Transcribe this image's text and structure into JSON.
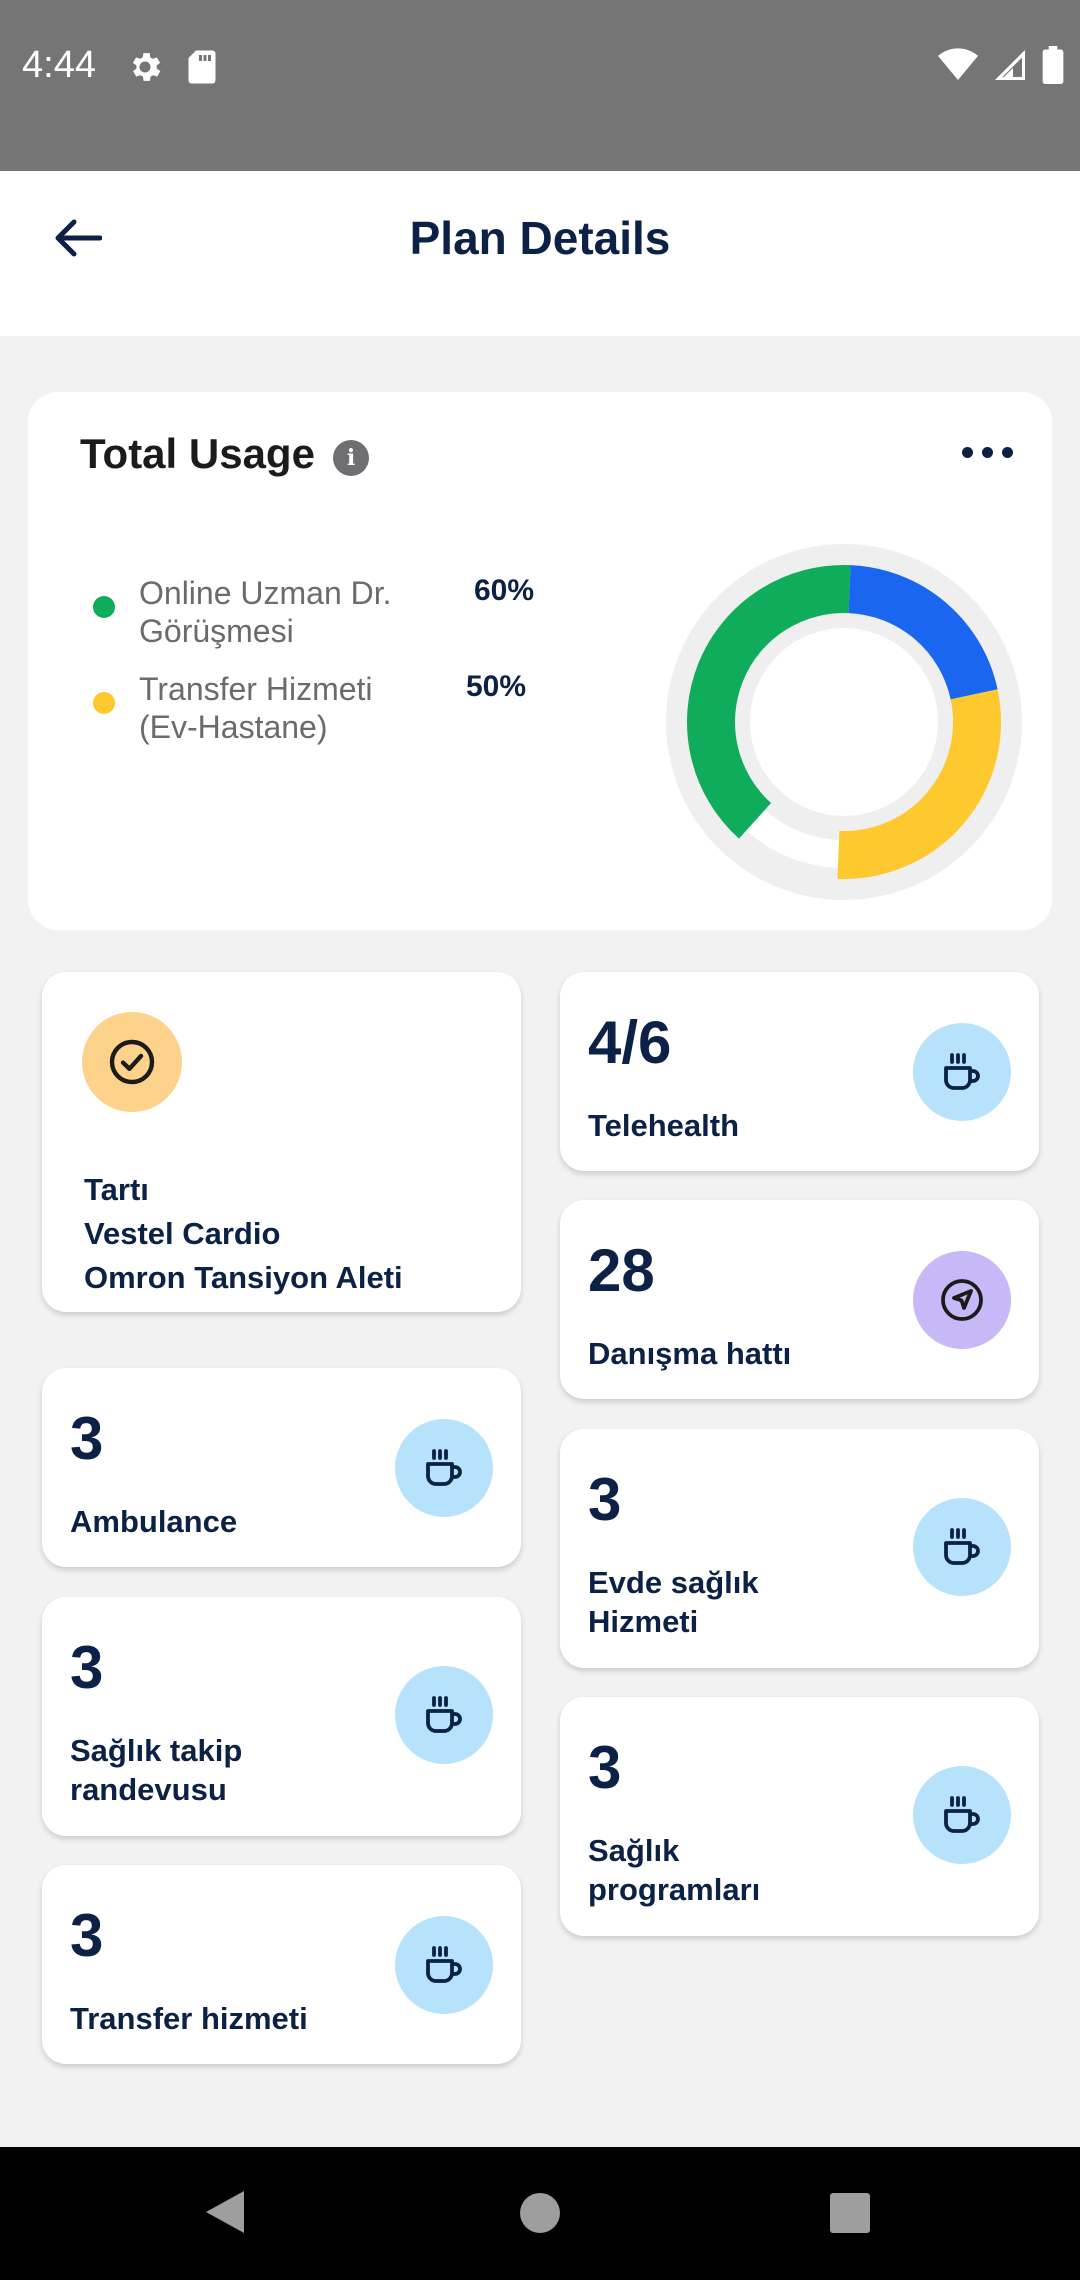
{
  "status_bar": {
    "time": "4:44"
  },
  "header": {
    "title": "Plan Details"
  },
  "usage": {
    "title": "Total Usage",
    "legend": [
      {
        "label": "Online Uzman Dr. Görüşmesi",
        "value": "60%",
        "color": "#0fad5b"
      },
      {
        "label": "Transfer Hizmeti (Ev-Hastane)",
        "value": "50%",
        "color": "#fdc92f"
      }
    ],
    "chart_data": {
      "type": "donut",
      "segments": [
        {
          "color": "#0fad5b",
          "fraction": 0.39
        },
        {
          "color": "#1a66f0",
          "fraction": 0.21
        },
        {
          "color": "#fdc92f",
          "fraction": 0.29
        }
      ]
    }
  },
  "tiles": {
    "devices": {
      "items": [
        "Tartı",
        "Vestel Cardio",
        "Omron Tansiyon Aleti"
      ]
    },
    "telehealth": {
      "value": "4/6",
      "label": "Telehealth"
    },
    "danisma": {
      "value": "28",
      "label": "Danışma hattı"
    },
    "ambulance": {
      "value": "3",
      "label": "Ambulance"
    },
    "evde": {
      "value": "3",
      "label": "Evde sağlık Hizmeti"
    },
    "saglik_takip": {
      "value": "3",
      "label": "Sağlık takip randevusu"
    },
    "saglik_prog": {
      "value": "3",
      "label": "Sağlık programları"
    },
    "transfer": {
      "value": "3",
      "label": "Transfer hizmeti"
    }
  },
  "colors": {
    "accent": "#0b2145",
    "icon_blue": "#b6e3fb",
    "icon_purple": "#c9b8f7",
    "check_bg": "#fdd38b"
  }
}
